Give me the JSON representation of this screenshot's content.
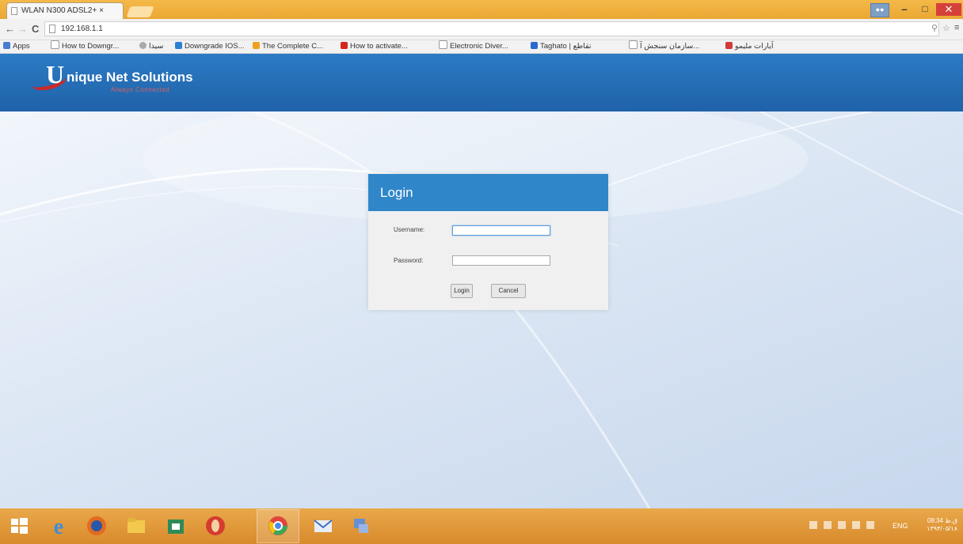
{
  "browser": {
    "tab_title": "WLAN N300 ADSL2+ ×",
    "url": "192.168.1.1",
    "nav": {
      "back": "←",
      "forward": "→",
      "reload": "C"
    },
    "window_controls": {
      "minimize": "–",
      "maximize": "□",
      "close": "✕"
    }
  },
  "bookmarks": [
    {
      "label": "Apps",
      "icon": "apps-grid-icon",
      "color": "#4a7bd0"
    },
    {
      "label": "How to Downgr...",
      "icon": "page-icon",
      "color": "#ffffff"
    },
    {
      "label": "سیدا",
      "icon": "globe-icon",
      "color": "#888888"
    },
    {
      "label": "Downgrade IOS...",
      "icon": "blue-box-icon",
      "color": "#2d7fd1"
    },
    {
      "label": "The Complete C...",
      "icon": "arrow-icon",
      "color": "#f0a020"
    },
    {
      "label": "How to activate...",
      "icon": "video-icon",
      "color": "#d2261f"
    },
    {
      "label": "Electronic Diver...",
      "icon": "page-icon",
      "color": "#ffffff"
    },
    {
      "label": "Taghato | تقاطع",
      "icon": "plus-icon",
      "color": "#2a6bd1"
    },
    {
      "label": "سازمان سنجش آ...",
      "icon": "page-icon",
      "color": "#ffffff"
    },
    {
      "label": "آیارات مليمو",
      "icon": "red-logo-icon",
      "color": "#d13a3a"
    }
  ],
  "header": {
    "logo_letter": "U",
    "brand": "nique Net Solutions",
    "tagline": "Always Connected"
  },
  "login": {
    "title": "Login",
    "username_label": "Username:",
    "username_value": "",
    "password_label": "Password:",
    "password_value": "",
    "login_button": "Login",
    "cancel_button": "Cancel"
  },
  "taskbar": {
    "apps": [
      {
        "name": "start-icon",
        "color": "#ffffff"
      },
      {
        "name": "internet-explorer-icon",
        "color": "#3b8fd9"
      },
      {
        "name": "firefox-icon",
        "color": "#e36b1f"
      },
      {
        "name": "file-explorer-icon",
        "color": "#f2c94c"
      },
      {
        "name": "store-icon",
        "color": "#2e8b57"
      },
      {
        "name": "opera-icon",
        "color": "#d63b2f"
      },
      {
        "name": "chrome-icon",
        "color": "#e8a83a"
      },
      {
        "name": "mail-icon",
        "color": "#3d6fc0"
      },
      {
        "name": "network-tool-icon",
        "color": "#6a8fd0"
      }
    ],
    "language": "ENG",
    "clock_time": "08:34 ق.ظ",
    "clock_date": "۱۳۹۴/۰۵/۱۸"
  }
}
